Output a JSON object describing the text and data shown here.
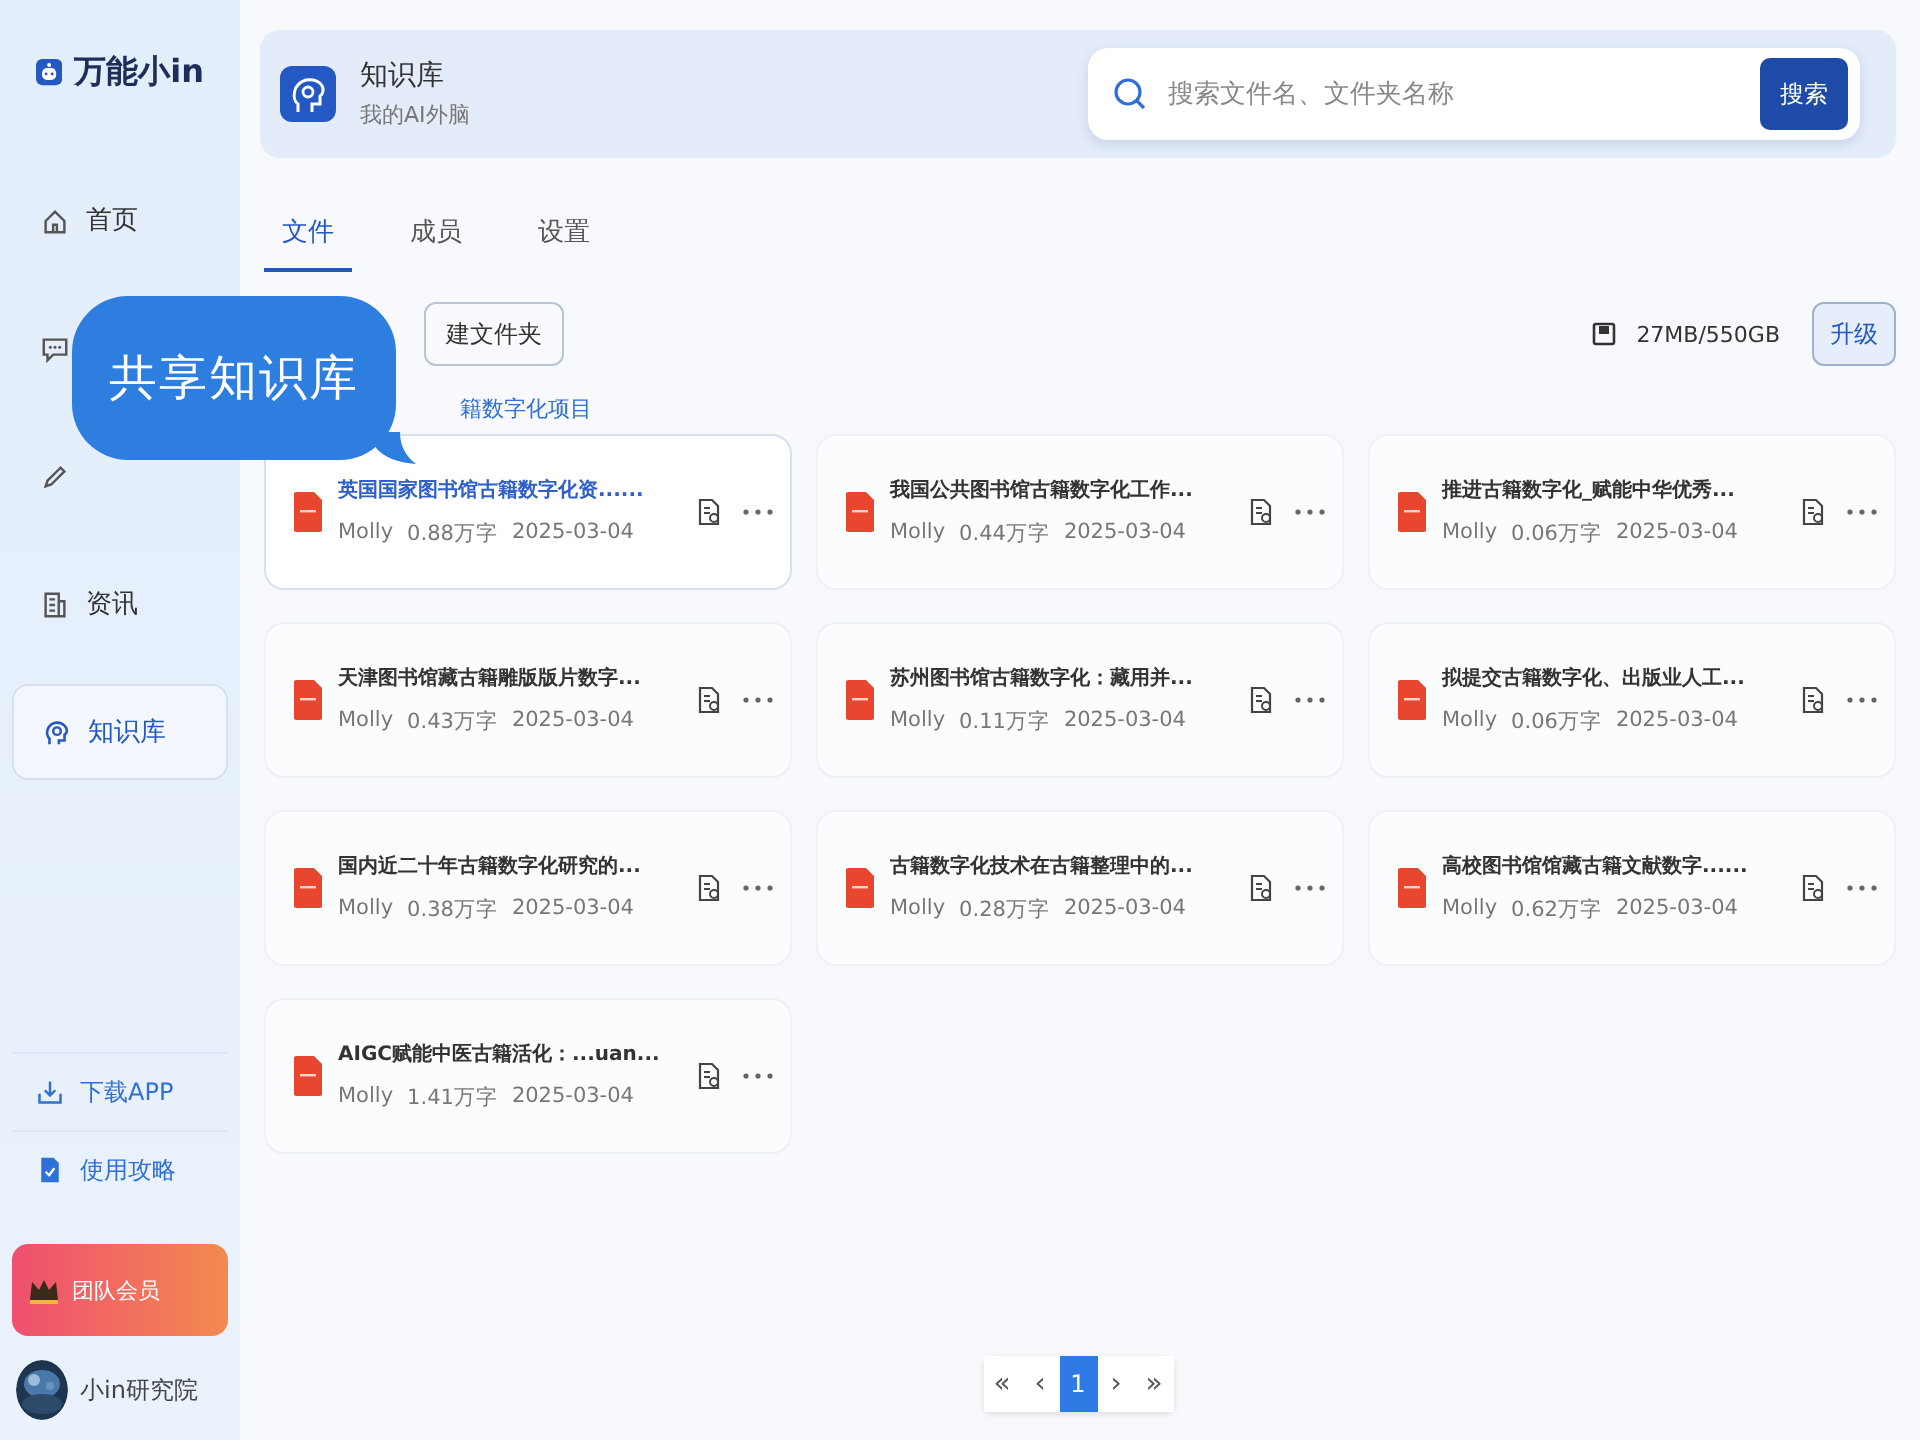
{
  "app": {
    "name": "万能小in"
  },
  "sidebar": {
    "items": [
      {
        "label": "首页",
        "selected": false
      },
      {
        "selected": false
      },
      {
        "selected": false
      },
      {
        "label": "资讯",
        "selected": false
      },
      {
        "label": "知识库",
        "selected": true
      }
    ],
    "links": [
      {
        "label": "下载APP"
      },
      {
        "label": "使用攻略"
      }
    ],
    "member_button": "团队会员",
    "user": {
      "name": "小in研究院"
    }
  },
  "header": {
    "title": "知识库",
    "subtitle": "我的AI外脑",
    "search": {
      "placeholder": "搜索文件名、文件夹名称",
      "button": "搜索"
    }
  },
  "tabs": [
    {
      "label": "文件",
      "selected": true
    },
    {
      "label": "成员",
      "selected": false
    },
    {
      "label": "设置",
      "selected": false
    }
  ],
  "toolbar": {
    "new_folder": "建文件夹",
    "storage": "27MB/550GB",
    "upgrade": "升级"
  },
  "breadcrumb": "籍数字化项目",
  "callout": "共享知识库",
  "files": [
    {
      "title": "英国国家图书馆古籍数字化资......",
      "author": "Molly",
      "words": "0.88万字",
      "date": "2025-03-04",
      "highlighted": true
    },
    {
      "title": "我国公共图书馆古籍数字化工作...",
      "author": "Molly",
      "words": "0.44万字",
      "date": "2025-03-04",
      "highlighted": false
    },
    {
      "title": "推进古籍数字化_赋能中华优秀...",
      "author": "Molly",
      "words": "0.06万字",
      "date": "2025-03-04",
      "highlighted": false
    },
    {
      "title": "天津图书馆藏古籍雕版版片数字...",
      "author": "Molly",
      "words": "0.43万字",
      "date": "2025-03-04",
      "highlighted": false
    },
    {
      "title": "苏州图书馆古籍数字化：藏用并...",
      "author": "Molly",
      "words": "0.11万字",
      "date": "2025-03-04",
      "highlighted": false
    },
    {
      "title": "拟提交古籍数字化、出版业人工...",
      "author": "Molly",
      "words": "0.06万字",
      "date": "2025-03-04",
      "highlighted": false
    },
    {
      "title": "国内近二十年古籍数字化研究的...",
      "author": "Molly",
      "words": "0.38万字",
      "date": "2025-03-04",
      "highlighted": false
    },
    {
      "title": "古籍数字化技术在古籍整理中的...",
      "author": "Molly",
      "words": "0.28万字",
      "date": "2025-03-04",
      "highlighted": false
    },
    {
      "title": "高校图书馆馆藏古籍文献数字......",
      "author": "Molly",
      "words": "0.62万字",
      "date": "2025-03-04",
      "highlighted": false
    },
    {
      "title": "AIGC赋能中医古籍活化：...uan...",
      "author": "Molly",
      "words": "1.41万字",
      "date": "2025-03-04",
      "highlighted": false
    }
  ],
  "pagination": {
    "first": "«",
    "prev": "‹",
    "pages": [
      {
        "label": "1",
        "selected": true
      }
    ],
    "next": "›",
    "last": "»"
  }
}
